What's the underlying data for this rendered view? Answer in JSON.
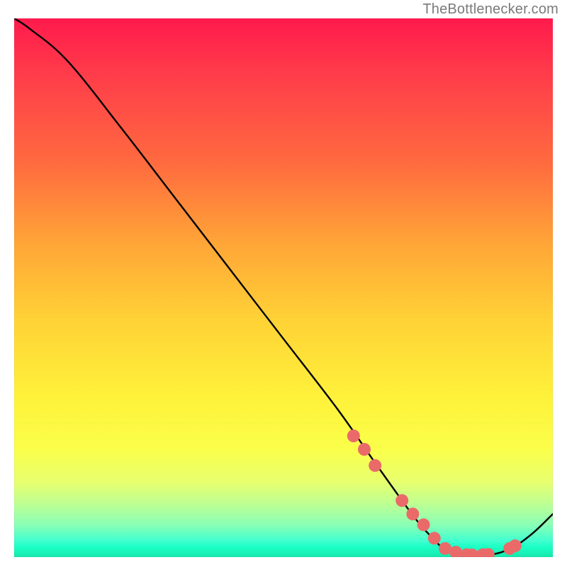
{
  "watermark": "TheBottlenecker.com",
  "chart_data": {
    "type": "line",
    "title": "",
    "xlabel": "",
    "ylabel": "",
    "xlim": [
      0,
      100
    ],
    "ylim": [
      0,
      100
    ],
    "x": [
      0,
      3,
      10,
      20,
      30,
      40,
      50,
      60,
      67,
      72,
      75,
      78,
      80,
      84,
      88,
      92,
      96,
      100
    ],
    "values": [
      100,
      98,
      92,
      79.5,
      66.5,
      53.5,
      40.5,
      27.5,
      17.5,
      10.5,
      6.5,
      3.2,
      1.5,
      0.4,
      0.4,
      1.5,
      4.2,
      8.0
    ],
    "markers": {
      "x": [
        63,
        65,
        67,
        72,
        74,
        76,
        78,
        80,
        82,
        84,
        85,
        87,
        88,
        92,
        93
      ],
      "values": [
        22.5,
        20.0,
        17.0,
        10.5,
        8.0,
        6.0,
        3.5,
        1.6,
        0.9,
        0.45,
        0.4,
        0.45,
        0.5,
        1.6,
        2.1
      ],
      "color": "#ea6a6a",
      "radius": 9
    },
    "line_color": "#000000",
    "background_gradient": {
      "stops": [
        {
          "pos": 0.0,
          "color": "#ff1a4c"
        },
        {
          "pos": 0.27,
          "color": "#ff6b3f"
        },
        {
          "pos": 0.56,
          "color": "#ffd236"
        },
        {
          "pos": 0.8,
          "color": "#faff4a"
        },
        {
          "pos": 0.94,
          "color": "#8affb5"
        },
        {
          "pos": 1.0,
          "color": "#19ffc3"
        }
      ]
    }
  }
}
